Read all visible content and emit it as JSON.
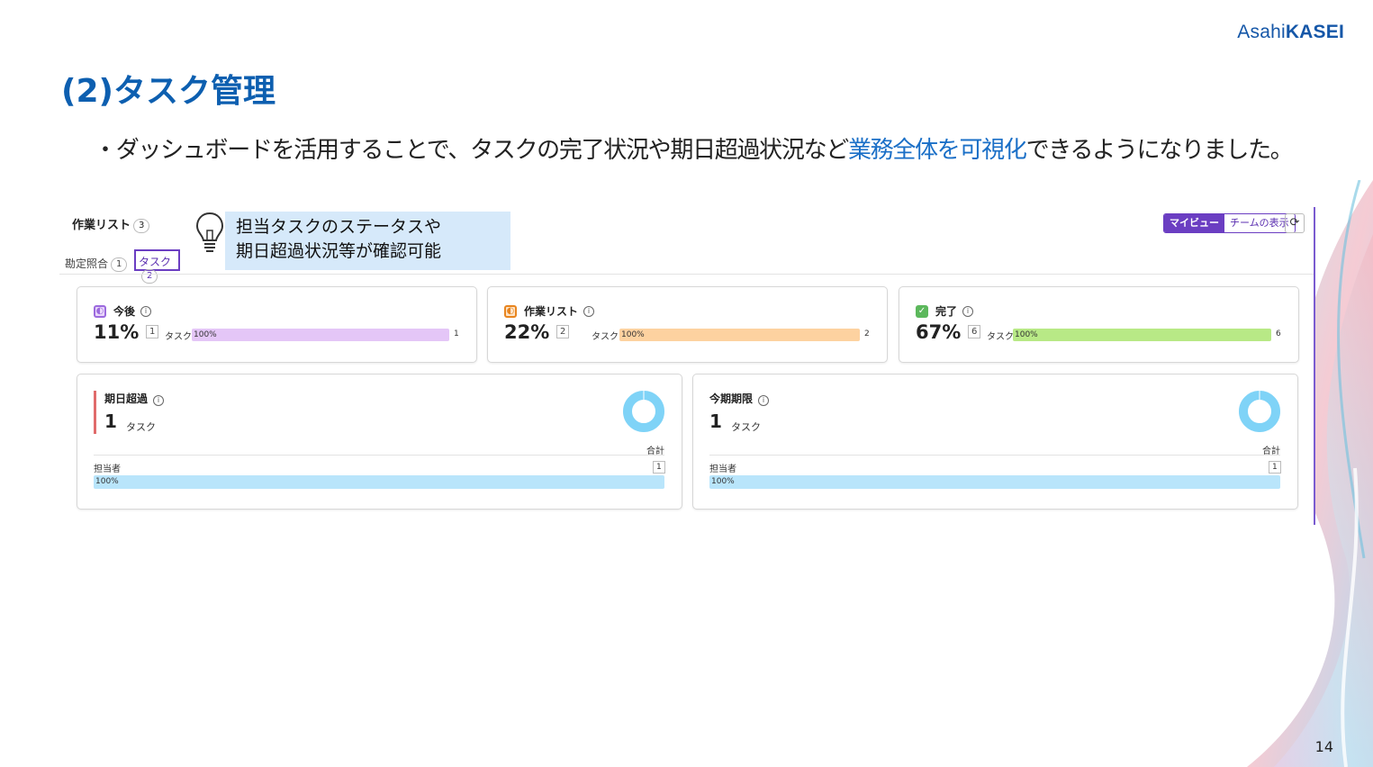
{
  "logo": {
    "part1": "Asahi",
    "part2": "KASEI"
  },
  "title": "(2)タスク管理",
  "bullet": {
    "prefix": "・ダッシュボードを活用することで、タスクの完了状況や期日超過状況など",
    "highlight": "業務全体を可視化",
    "suffix": "できるようになりました。"
  },
  "slide_number": "14",
  "app": {
    "worklist_label": "作業リスト",
    "worklist_count": "3",
    "tabs": [
      {
        "label": "勘定照合",
        "count": "1"
      },
      {
        "label": "タスク",
        "count": "2"
      }
    ],
    "callout": {
      "line1": "担当タスクのステータスや",
      "line2": "期日超過状況等が確認可能"
    },
    "view_toggle": {
      "my_view": "マイビュー",
      "team_view": "チームの表示"
    },
    "refresh_icon": "refresh-icon",
    "status_cards": [
      {
        "label": "今後",
        "percent": "11%",
        "count": "1",
        "unit": "タスク",
        "bar_label": "100%",
        "bar_end": "1",
        "color": "#e4c6f7",
        "icon_color": "#9c6ade"
      },
      {
        "label": "作業リスト",
        "percent": "22%",
        "count": "2",
        "unit": "タスク",
        "bar_label": "100%",
        "bar_end": "2",
        "color": "#fdd2a0",
        "icon_color": "#e8851f"
      },
      {
        "label": "完了",
        "percent": "67%",
        "count": "6",
        "unit": "タスク",
        "bar_label": "100%",
        "bar_end": "6",
        "color": "#b8e986",
        "icon_color": "#5cb85c"
      }
    ],
    "deadline_cards": [
      {
        "label": "期日超過",
        "count": "1",
        "unit": "タスク",
        "total_label": "合計",
        "assignee_label": "担当者",
        "assignee_count": "1",
        "bar_label": "100%",
        "accent": true
      },
      {
        "label": "今期期限",
        "count": "1",
        "unit": "タスク",
        "total_label": "合計",
        "assignee_label": "担当者",
        "assignee_count": "1",
        "bar_label": "100%",
        "accent": false
      }
    ],
    "donut_color": "#7fd3f7"
  }
}
